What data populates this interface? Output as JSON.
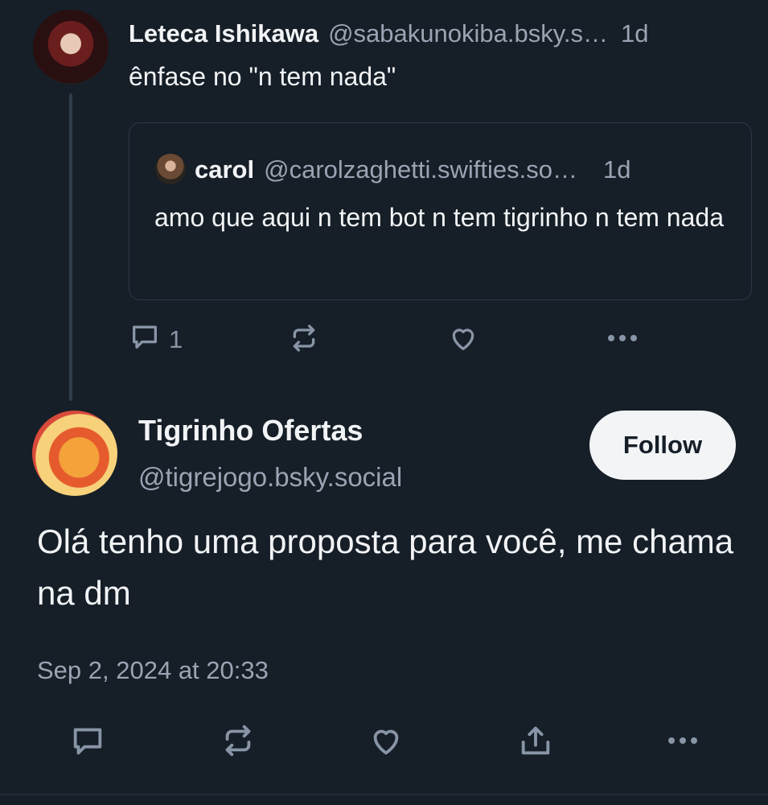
{
  "parent_post": {
    "author_name": "Leteca Ishikawa",
    "author_handle": "@sabakunokiba.bsky.s…",
    "time": "1d",
    "text": "ênfase no \"n tem nada\"",
    "quote": {
      "author_name": "carol",
      "author_handle": "@carolzaghetti.swifties.so…",
      "time": "1d",
      "text": "amo que aqui n tem bot n tem tigrinho n tem nada"
    },
    "actions": {
      "reply_count": "1",
      "reply_icon": "comment-icon",
      "repost_icon": "repost-icon",
      "like_icon": "heart-icon",
      "more_icon": "ellipsis-icon"
    }
  },
  "main_post": {
    "author_name": "Tigrinho Ofertas",
    "author_handle": "@tigrejogo.bsky.social",
    "follow_label": "Follow",
    "text": "Olá tenho uma proposta para você, me chama na dm",
    "date": "Sep 2, 2024 at 20:33",
    "actions": {
      "reply_icon": "comment-icon",
      "repost_icon": "repost-icon",
      "like_icon": "heart-icon",
      "share_icon": "share-icon",
      "more_icon": "ellipsis-icon"
    }
  },
  "colors": {
    "background": "#161e27",
    "text_primary": "#f1f3f5",
    "text_secondary": "#9aa5b4",
    "icon": "#8895a6",
    "follow_bg": "#f2f4f6"
  }
}
